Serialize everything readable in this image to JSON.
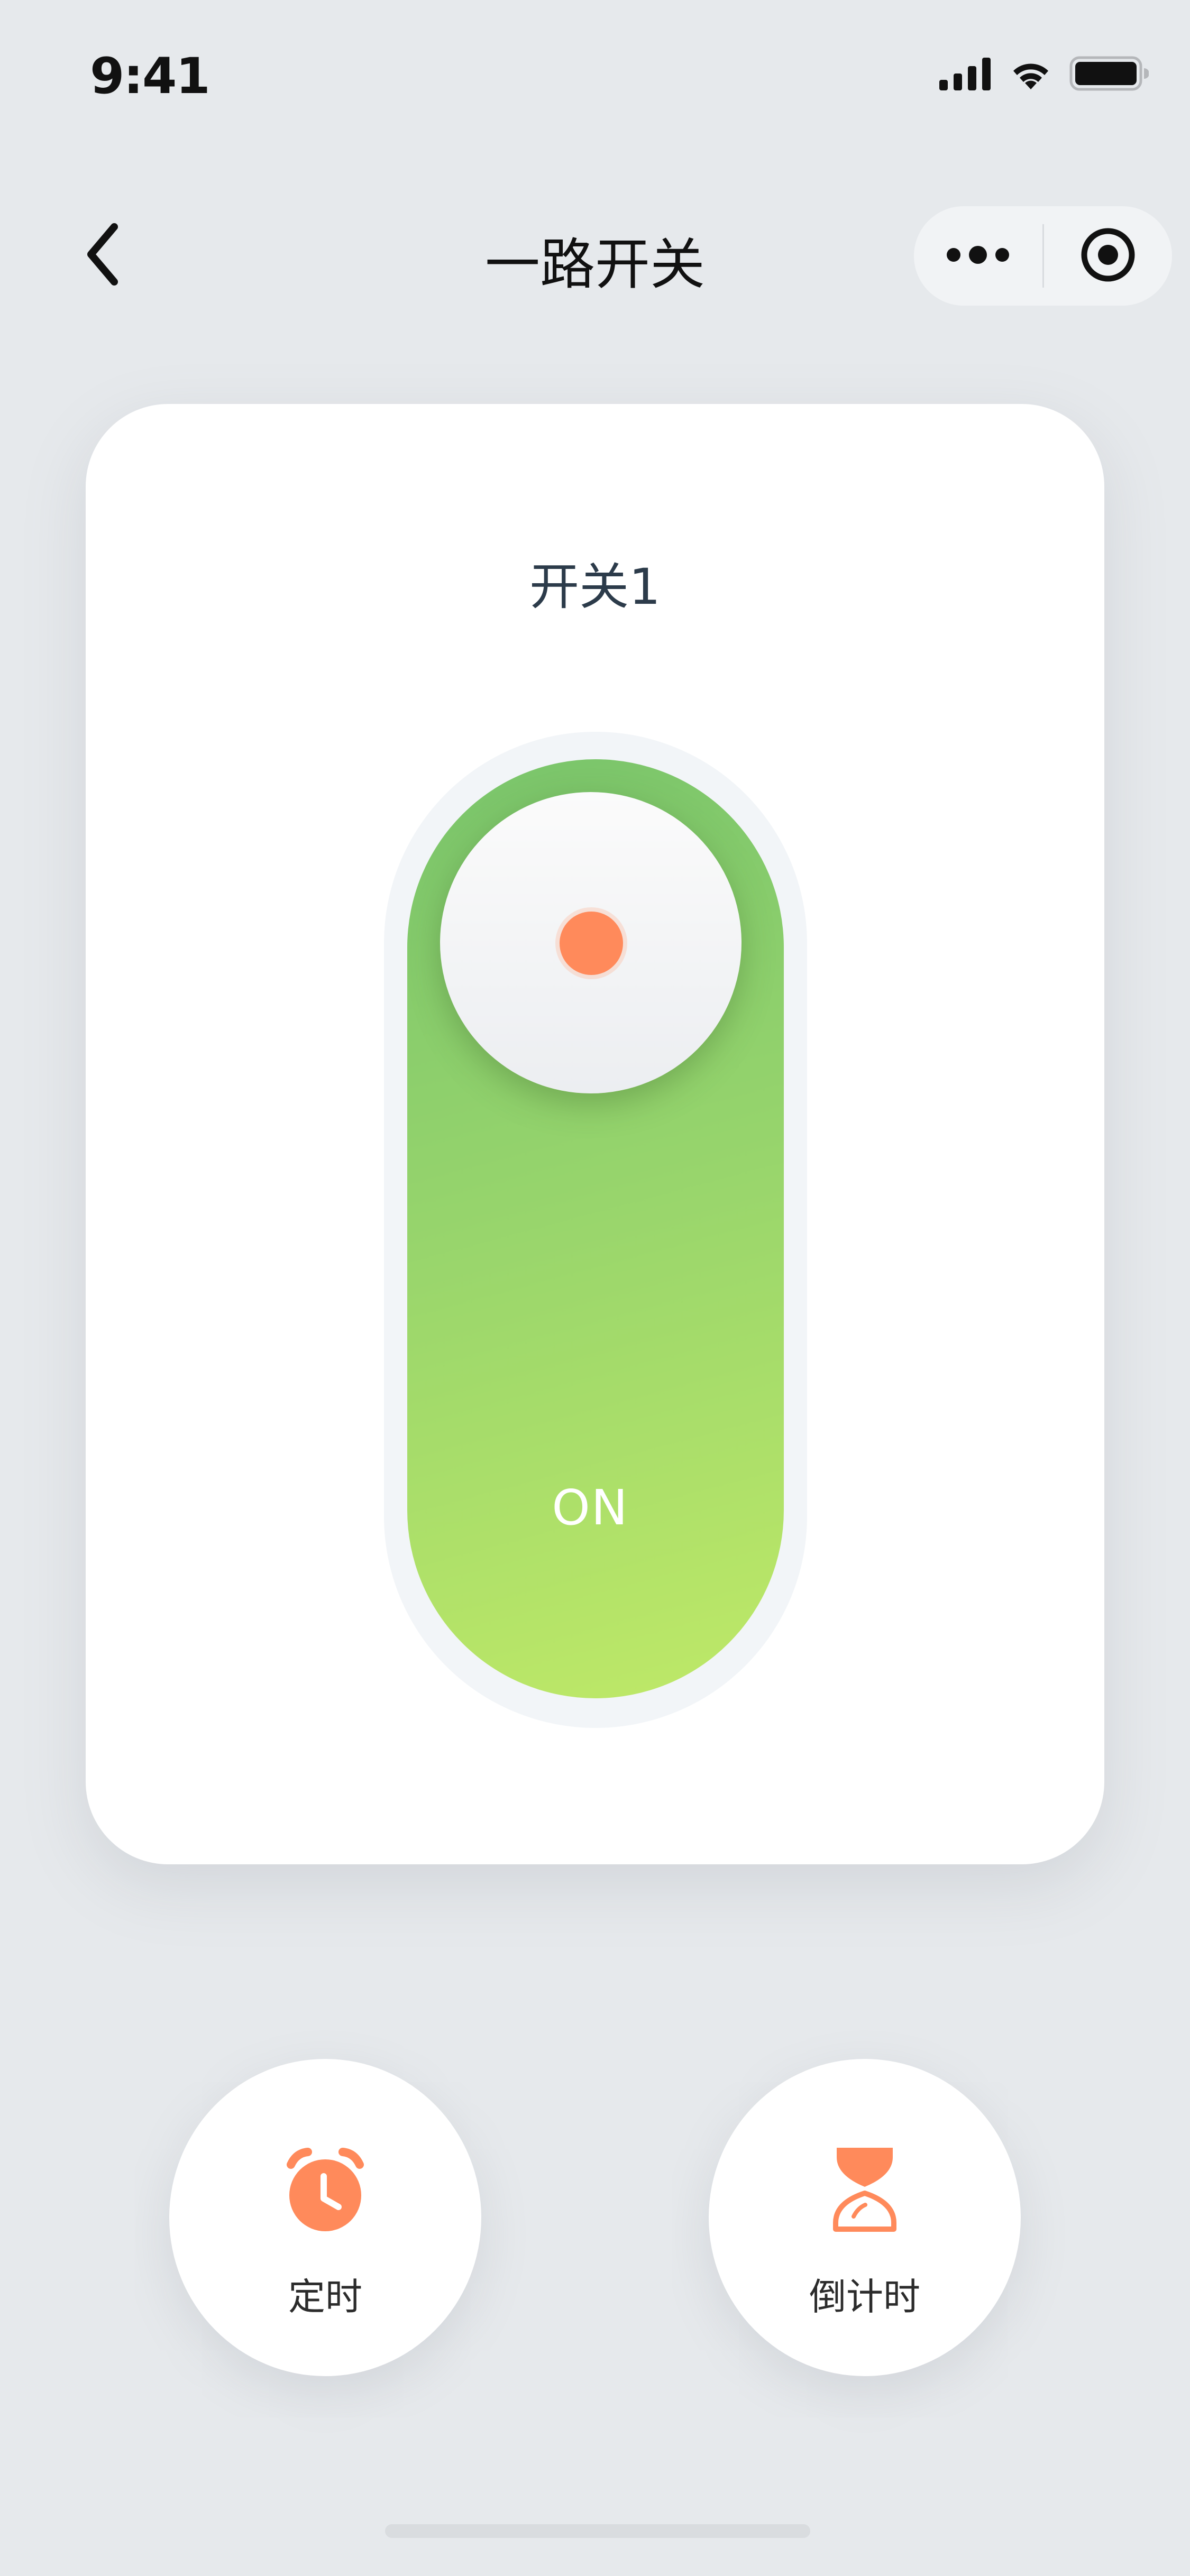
{
  "status_bar": {
    "time": "9:41",
    "icons": [
      "signal-icon",
      "wifi-icon",
      "battery-icon"
    ]
  },
  "nav": {
    "title": "一路开关",
    "back_icon": "chevron-left-icon",
    "menu_icon": "more-dots-icon",
    "close_icon": "target-circle-icon"
  },
  "card": {
    "title": "开关1",
    "switch": {
      "state": "ON",
      "accent_color": "#ff8a5b",
      "track_colors": [
        "#79c46b",
        "#bfe967"
      ]
    }
  },
  "actions": [
    {
      "label": "定时",
      "icon": "alarm-clock-icon"
    },
    {
      "label": "倒计时",
      "icon": "hourglass-icon"
    }
  ],
  "colors": {
    "background": "#e6e9ec",
    "accent": "#ff8a5b"
  }
}
